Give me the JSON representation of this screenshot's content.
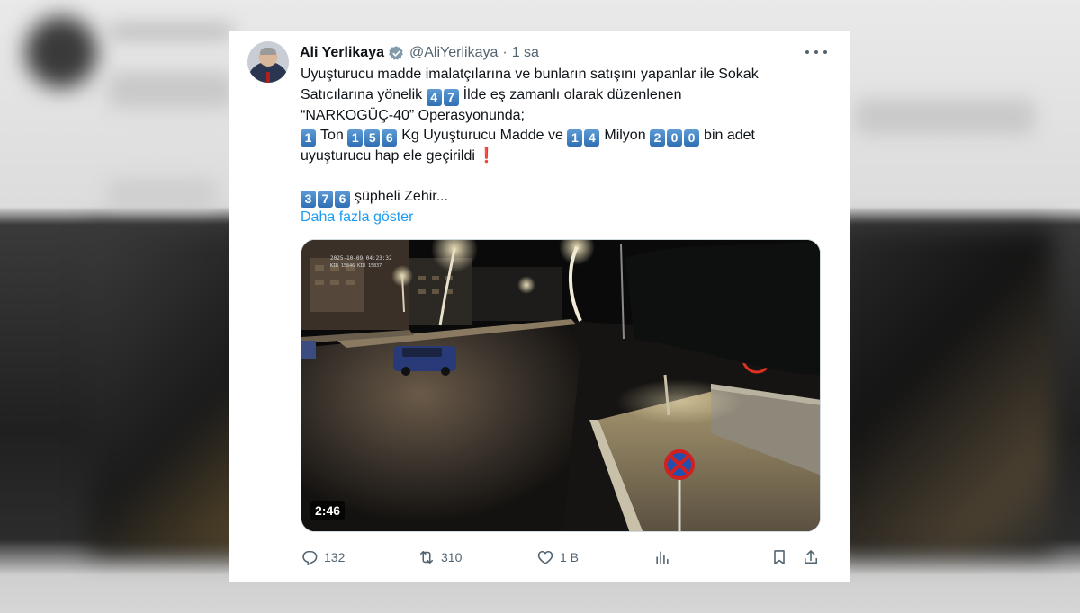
{
  "tweet": {
    "author": {
      "name": "Ali Yerlikaya",
      "handle": "@AliYerlikaya",
      "verified": true
    },
    "separator": "·",
    "time": "1 sa",
    "body": {
      "line1": "Uyuşturucu madde imalatçılarına ve bunların satışını yapanlar ile Sokak",
      "line2_before": "Satıcılarına yönelik",
      "line2_digits": [
        "4",
        "7"
      ],
      "line2_after": "İlde eş zamanlı olarak düzenlenen",
      "line3": "“NARKOGÜÇ-40” Operasyonunda;",
      "line4_d1": [
        "1"
      ],
      "line4_t1": "Ton",
      "line4_d2": [
        "1",
        "5",
        "6"
      ],
      "line4_t2": "Kg Uyuşturucu Madde ve",
      "line4_d3": [
        "1",
        "4"
      ],
      "line4_t3": "Milyon",
      "line4_d4": [
        "2",
        "0",
        "0"
      ],
      "line4_t4": "bin adet",
      "line5": "uyuşturucu hap ele geçirildi",
      "line5_emoji": "❗",
      "line6_digits": [
        "3",
        "7",
        "6"
      ],
      "line6_text": "şüpheli Zehir..."
    },
    "show_more": "Daha fazla göster",
    "video": {
      "duration": "2:46",
      "overlay_stamp_1": "2025-10-09 04:23:32",
      "overlay_stamp_2": "KIR 15846 KIR 15837"
    },
    "actions": {
      "replies": "132",
      "reposts": "310",
      "likes": "1 B"
    },
    "colors": {
      "link": "#1d9bf0",
      "muted": "#536471",
      "keycap": "#3a7cc2",
      "verified_badge": "#829aab"
    },
    "icons": [
      "verified-badge-icon",
      "more-icon",
      "reply-icon",
      "repost-icon",
      "like-icon",
      "views-icon",
      "bookmark-icon",
      "share-icon"
    ]
  }
}
